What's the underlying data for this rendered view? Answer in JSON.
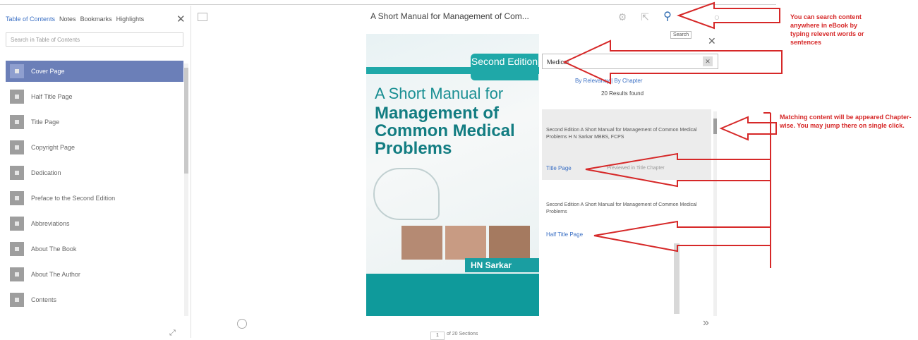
{
  "left_panel": {
    "tabs": [
      "Table of Contents",
      "Notes",
      "Bookmarks",
      "Highlights"
    ],
    "search_placeholder": "Search in Table of Contents",
    "toc_items": [
      "Cover Page",
      "Half Title Page",
      "Title Page",
      "Copyright Page",
      "Dedication",
      "Preface to the Second Edition",
      "Abbreviations",
      "About The Book",
      "About The Author",
      "Contents"
    ],
    "close_icon": "close-icon"
  },
  "header": {
    "title": "A Short Manual for Management of Com...",
    "icons": [
      "settings-icon",
      "export-icon",
      "search-icon",
      "info-icon"
    ]
  },
  "book_cover": {
    "edition": "Second Edition",
    "line1": "A Short Manual for",
    "line2": "Management of Common Medical Problems",
    "author": "HN Sarkar"
  },
  "search_panel": {
    "tooltip": "Search",
    "query": "Medical",
    "sort_text": "By Relevancy | By Chapter",
    "results_found": "20 Results found",
    "results": [
      {
        "snippet": "Second Edition A Short Manual for Management of Common Medical Problems H N Sarkar MBBS, FCPS",
        "link": "Title Page",
        "grey": "Previewed in Title Chapter"
      },
      {
        "snippet": "Second Edition A Short Manual for Management of Common Medical Problems",
        "link": "Half Title Page",
        "grey": ""
      }
    ]
  },
  "footer": {
    "page_number": "1",
    "page_of": "of 20 Sections"
  },
  "annotations": {
    "search_note": "You can search content anywhere in eBook by typing relevent words or sentences",
    "match_note": "Matching content will be appeared Chapter-wise. You may jump there on single click."
  },
  "colors": {
    "accent_blue": "#3a6fc4",
    "toc_active": "#6b7fb8",
    "cover_teal": "#1fa8a8",
    "annotation_red": "#d62828"
  }
}
